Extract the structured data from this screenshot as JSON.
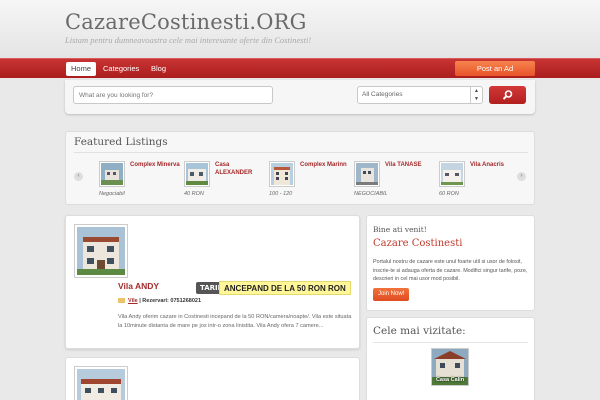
{
  "site": {
    "title": "CazareCostinesti.ORG",
    "tagline": "Listam pentru dumneavoastra cele mai interesante oferte din Costinesti!"
  },
  "nav": {
    "items": [
      {
        "label": "Home",
        "active": true
      },
      {
        "label": "Categories",
        "active": false
      },
      {
        "label": "Blog",
        "active": false
      }
    ],
    "post_ad": "Post an Ad"
  },
  "search": {
    "placeholder": "What are you looking for?",
    "category_value": "All Categories"
  },
  "featured": {
    "title": "Featured Listings",
    "prev_label": "‹",
    "next_label": "›",
    "items": [
      {
        "name": "Complex Minerva",
        "price": "Negociabil"
      },
      {
        "name": "Casa ALEXANDER",
        "price": "40 RON"
      },
      {
        "name": "Complex Marinn",
        "price": "100 - 120"
      },
      {
        "name": "Vila TANASE",
        "price": "NEGOCIABIL"
      },
      {
        "name": "Vila Anacris",
        "price": "60 RON"
      }
    ]
  },
  "listing": {
    "title": "Vila ANDY",
    "tarif_badge": "TARIF:",
    "tarif_text": "ANCEPAND DE LA 50 RON RON",
    "category": "Vile",
    "reservation": "| Rezervari: 0751268021",
    "excerpt": "Vila Andy oferim cazare in Costinesti incepand de la 50 RON/camera/noapte/. Vila este situata la 10minute distanta de mare pe jos intr-o zona linistita. Vila Andy ofera 7 camere..."
  },
  "welcome": {
    "heading": "Bine ati venit!",
    "title": "Cazare Costinesti",
    "text": "Portalul nostru de cazare este unul foarte util si usor de folosit, inscrie-te si adauga oferta de cazare. Modifici singur tarife, poze, descrieri in cel mai usor mod posibil.",
    "button": "Join Now!"
  },
  "popular": {
    "title": "Cele mai vizitate:",
    "item_label": "Casa Calin"
  },
  "colors": {
    "brand_red": "#b52222",
    "accent_orange": "#e8532a"
  }
}
